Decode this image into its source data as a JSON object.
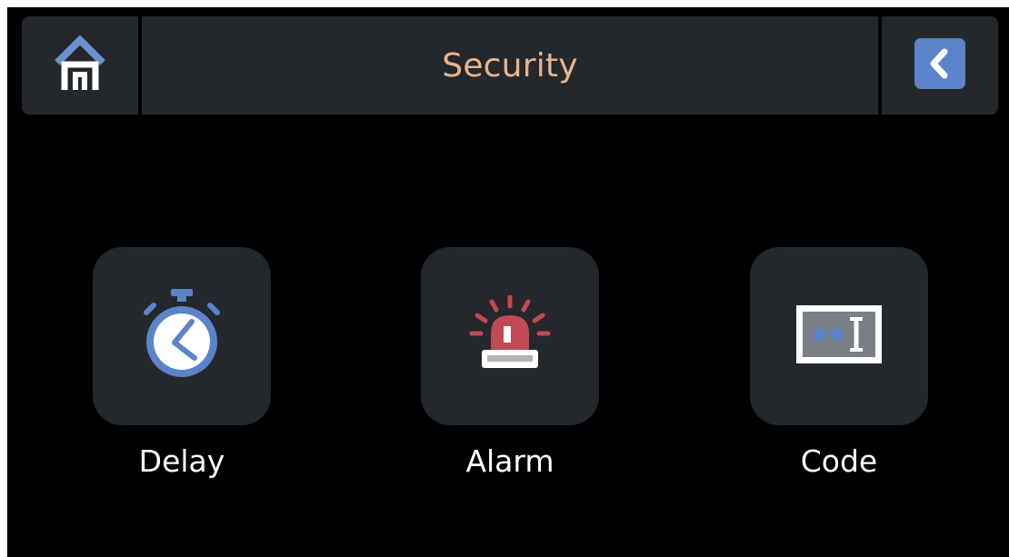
{
  "header": {
    "title": "Security",
    "home_icon": "home-icon",
    "back_icon": "chevron-left-icon"
  },
  "tiles": [
    {
      "label": "Delay",
      "icon": "stopwatch-icon"
    },
    {
      "label": "Alarm",
      "icon": "siren-icon"
    },
    {
      "label": "Code",
      "icon": "password-field-icon"
    }
  ],
  "colors": {
    "background": "#000000",
    "panel": "#24272b",
    "title": "#e5b591",
    "accent_blue": "#5b83c9",
    "alarm_red": "#c24a55",
    "text": "#ffffff"
  }
}
